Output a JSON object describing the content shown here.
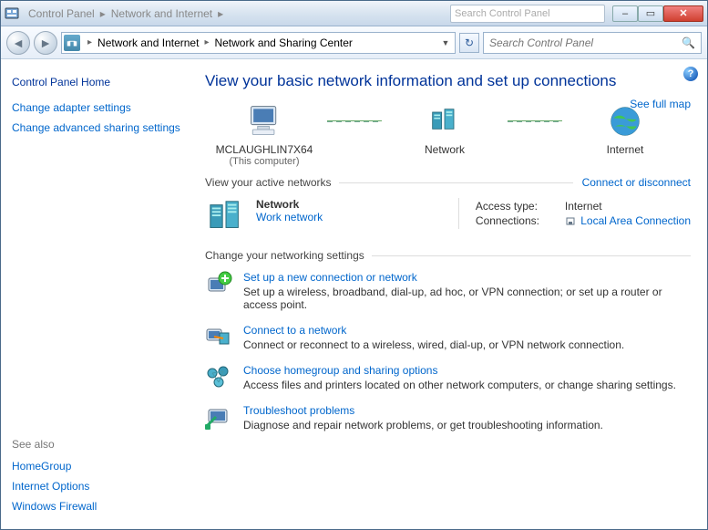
{
  "titlebar": {
    "icon_label": "control-panel-icon",
    "crumb1": "Control Panel",
    "crumb2": "Network and Internet",
    "search_ghost": "Search Control Panel"
  },
  "window_buttons": {
    "min": "–",
    "max": "▭",
    "close": "✕"
  },
  "address": {
    "seg1": "Network and Internet",
    "seg2": "Network and Sharing Center"
  },
  "search": {
    "placeholder": "Search Control Panel"
  },
  "sidebar": {
    "home": "Control Panel Home",
    "links": [
      "Change adapter settings",
      "Change advanced sharing settings"
    ],
    "seealso_header": "See also",
    "seealso": [
      "HomeGroup",
      "Internet Options",
      "Windows Firewall"
    ]
  },
  "main": {
    "heading": "View your basic network information and set up connections",
    "map_link": "See full map",
    "nodes": {
      "computer": {
        "label": "MCLAUGHLIN7X64",
        "sub": "(This computer)"
      },
      "network": {
        "label": "Network"
      },
      "internet": {
        "label": "Internet"
      }
    },
    "active_hdr": "View your active networks",
    "active_link": "Connect or disconnect",
    "active": {
      "name": "Network",
      "type": "Work network",
      "access_k": "Access type:",
      "access_v": "Internet",
      "conn_k": "Connections:",
      "conn_v": "Local Area Connection"
    },
    "change_hdr": "Change your networking settings",
    "tasks": [
      {
        "title": "Set up a new connection or network",
        "desc": "Set up a wireless, broadband, dial-up, ad hoc, or VPN connection; or set up a router or access point."
      },
      {
        "title": "Connect to a network",
        "desc": "Connect or reconnect to a wireless, wired, dial-up, or VPN network connection."
      },
      {
        "title": "Choose homegroup and sharing options",
        "desc": "Access files and printers located on other network computers, or change sharing settings."
      },
      {
        "title": "Troubleshoot problems",
        "desc": "Diagnose and repair network problems, or get troubleshooting information."
      }
    ]
  }
}
